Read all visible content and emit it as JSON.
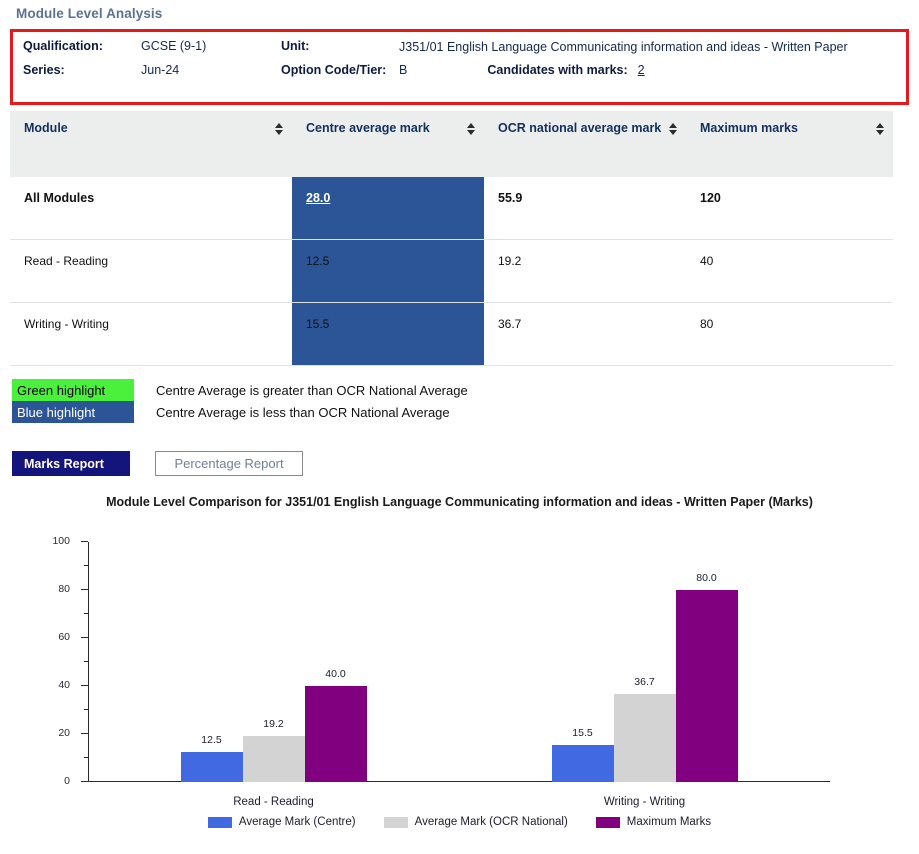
{
  "page_title": "Module Level Analysis",
  "info": {
    "qualification_label": "Qualification:",
    "qualification_value": "GCSE (9-1)",
    "unit_label": "Unit:",
    "unit_value": "J351/01 English Language Communicating information and ideas - Written Paper",
    "series_label": "Series:",
    "series_value": "Jun-24",
    "option_label": "Option Code/Tier:",
    "option_value": "B",
    "candidates_label": "Candidates with marks:",
    "candidates_value": "2"
  },
  "table": {
    "columns": [
      "Module",
      "Centre average mark",
      "OCR national average mark",
      "Maximum marks"
    ],
    "rows": [
      {
        "module": "All Modules",
        "centre_average": "28.0",
        "ocr_national": "55.9",
        "maximum": "120"
      },
      {
        "module": "Read - Reading",
        "centre_average": "12.5",
        "ocr_national": "19.2",
        "maximum": "40"
      },
      {
        "module": "Writing - Writing",
        "centre_average": "15.5",
        "ocr_national": "36.7",
        "maximum": "80"
      }
    ]
  },
  "key": {
    "green_chip": "Green highlight",
    "green_desc": "Centre Average is greater than OCR National Average",
    "blue_chip": "Blue highlight",
    "blue_desc": "Centre Average is less than OCR National Average",
    "green_color": "#4bf03c",
    "blue_color": "#2b5597"
  },
  "tabs": {
    "marks_report": "Marks Report",
    "percentage_report": "Percentage Report"
  },
  "chart_data": {
    "type": "bar",
    "title": "Module Level Comparison for J351/01 English Language Communicating information and ideas - Written Paper (Marks)",
    "xlabel": "",
    "ylabel": "",
    "ylim": [
      0,
      100
    ],
    "yticks": [
      0,
      20,
      40,
      60,
      80,
      100
    ],
    "ytick_labels": [
      "0",
      "20",
      "40",
      "60",
      "80",
      "100"
    ],
    "minor_ticks": [
      10,
      30,
      50,
      70,
      90
    ],
    "grid": false,
    "legend_position": "bottom",
    "categories": [
      "Read - Reading",
      "Writing - Writing"
    ],
    "series": [
      {
        "name": "Average Mark (Centre)",
        "color": "#4169e1",
        "values": [
          12.5,
          15.5
        ],
        "labels": [
          "12.5",
          "15.5"
        ]
      },
      {
        "name": "Average Mark (OCR National)",
        "color": "#d3d3d3",
        "values": [
          19.2,
          36.7
        ],
        "labels": [
          "19.2",
          "36.7"
        ]
      },
      {
        "name": "Maximum Marks",
        "color": "#800080",
        "values": [
          40.0,
          80.0
        ],
        "labels": [
          "40.0",
          "80.0"
        ]
      }
    ]
  }
}
